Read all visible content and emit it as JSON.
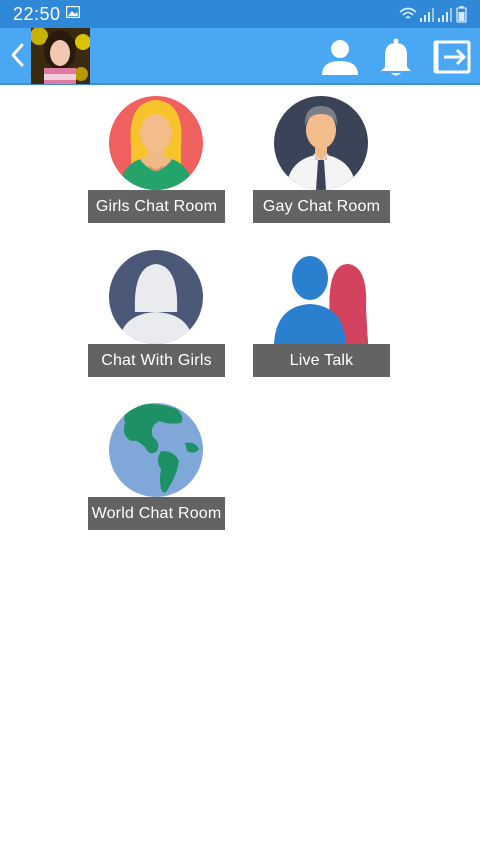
{
  "status_bar": {
    "time": "22:50",
    "icons": [
      "gallery-icon",
      "wifi-icon",
      "signal-icon",
      "signal-icon",
      "battery-icon"
    ]
  },
  "app_bar": {
    "icons": [
      "back-arrow-icon",
      "profile-icon",
      "bell-icon",
      "logout-icon"
    ],
    "background": "#4aa7f4"
  },
  "rooms": [
    {
      "label": "Girls Chat Room",
      "icon": "blonde-woman-icon"
    },
    {
      "label": "Gay Chat Room",
      "icon": "businessman-icon"
    },
    {
      "label": "Chat With Girls",
      "icon": "woman-silhouette-icon"
    },
    {
      "label": "Live Talk",
      "icon": "couple-silhouette-icon"
    },
    {
      "label": "World Chat Room",
      "icon": "globe-icon"
    }
  ],
  "colors": {
    "status_bar": "#2f88d8",
    "label_bg": "#636363",
    "label_text": "#ffffff"
  }
}
